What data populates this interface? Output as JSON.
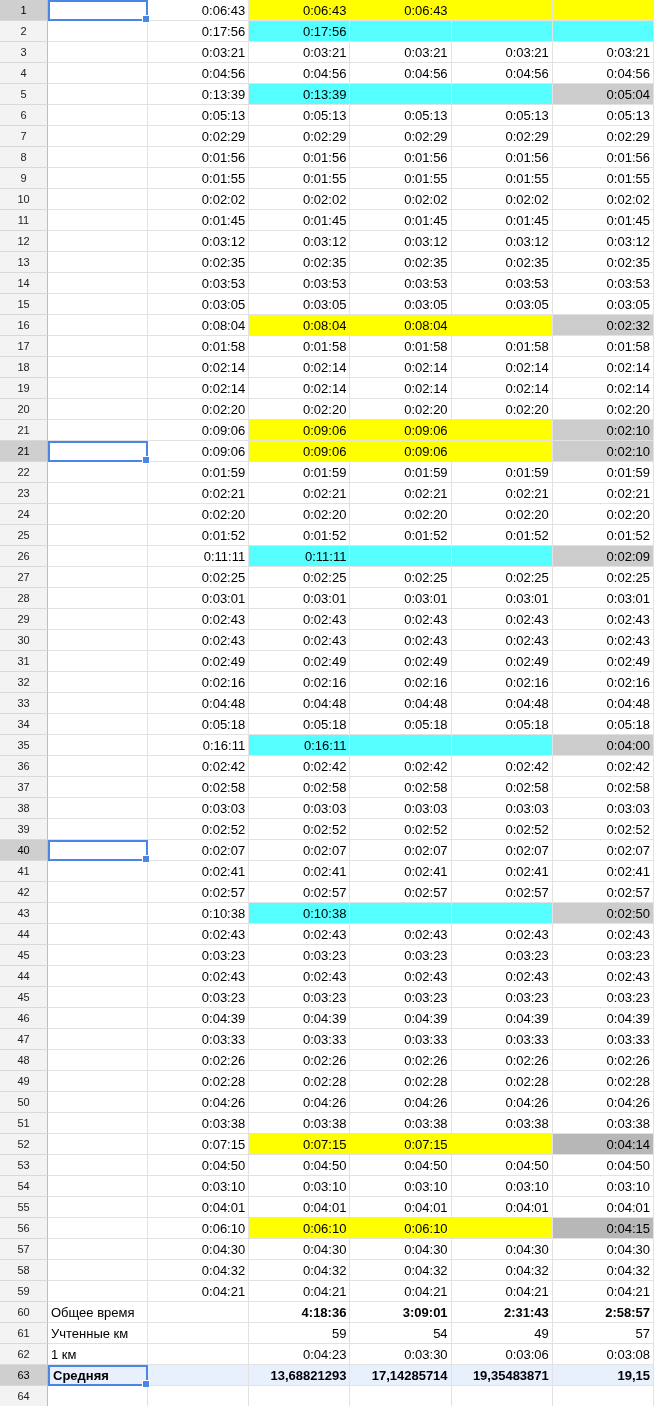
{
  "rows": [
    {
      "number": "1",
      "kind": "plain",
      "selected": true,
      "cells": [
        {},
        {
          "text": "0:06:43"
        },
        {
          "text": "0:06:43",
          "color": "#ffff00"
        },
        {
          "text": "0:06:43",
          "color": "#ffff00"
        },
        {
          "color": "#ffff00"
        },
        {
          "color": "#ffff00"
        }
      ]
    },
    {
      "number": "2",
      "kind": "plain",
      "selected": false,
      "cells": [
        {},
        {
          "text": "0:17:56"
        },
        {
          "text": "0:17:56",
          "color": "#55ffff"
        },
        {
          "color": "#55ffff"
        },
        {
          "color": "#55ffff"
        },
        {
          "color": "#55ffff"
        }
      ]
    },
    {
      "number": "3",
      "kind": "plain",
      "selected": false,
      "cells": [
        {},
        {
          "text": "0:03:21"
        },
        {
          "text": "0:03:21"
        },
        {
          "text": "0:03:21"
        },
        {
          "text": "0:03:21"
        },
        {
          "text": "0:03:21"
        }
      ]
    },
    {
      "number": "4",
      "kind": "plain",
      "selected": false,
      "cells": [
        {},
        {
          "text": "0:04:56"
        },
        {
          "text": "0:04:56"
        },
        {
          "text": "0:04:56"
        },
        {
          "text": "0:04:56"
        },
        {
          "text": "0:04:56"
        }
      ]
    },
    {
      "number": "5",
      "kind": "plain",
      "selected": false,
      "cells": [
        {},
        {
          "text": "0:13:39"
        },
        {
          "text": "0:13:39",
          "color": "#55ffff"
        },
        {
          "color": "#55ffff"
        },
        {
          "color": "#55ffff"
        },
        {
          "text": "0:05:04",
          "color": "#cccccc"
        }
      ]
    },
    {
      "number": "6",
      "kind": "plain",
      "selected": false,
      "cells": [
        {},
        {
          "text": "0:05:13"
        },
        {
          "text": "0:05:13"
        },
        {
          "text": "0:05:13"
        },
        {
          "text": "0:05:13"
        },
        {
          "text": "0:05:13"
        }
      ]
    },
    {
      "number": "7",
      "kind": "plain",
      "selected": false,
      "cells": [
        {},
        {
          "text": "0:02:29"
        },
        {
          "text": "0:02:29"
        },
        {
          "text": "0:02:29"
        },
        {
          "text": "0:02:29"
        },
        {
          "text": "0:02:29"
        }
      ]
    },
    {
      "number": "8",
      "kind": "plain",
      "selected": false,
      "cells": [
        {},
        {
          "text": "0:01:56"
        },
        {
          "text": "0:01:56"
        },
        {
          "text": "0:01:56"
        },
        {
          "text": "0:01:56"
        },
        {
          "text": "0:01:56"
        }
      ]
    },
    {
      "number": "9",
      "kind": "plain",
      "selected": false,
      "cells": [
        {},
        {
          "text": "0:01:55"
        },
        {
          "text": "0:01:55"
        },
        {
          "text": "0:01:55"
        },
        {
          "text": "0:01:55"
        },
        {
          "text": "0:01:55"
        }
      ]
    },
    {
      "number": "10",
      "kind": "plain",
      "selected": false,
      "cells": [
        {},
        {
          "text": "0:02:02"
        },
        {
          "text": "0:02:02"
        },
        {
          "text": "0:02:02"
        },
        {
          "text": "0:02:02"
        },
        {
          "text": "0:02:02"
        }
      ]
    },
    {
      "number": "11",
      "kind": "plain",
      "selected": false,
      "cells": [
        {},
        {
          "text": "0:01:45"
        },
        {
          "text": "0:01:45"
        },
        {
          "text": "0:01:45"
        },
        {
          "text": "0:01:45"
        },
        {
          "text": "0:01:45"
        }
      ]
    },
    {
      "number": "12",
      "kind": "plain",
      "selected": false,
      "cells": [
        {},
        {
          "text": "0:03:12"
        },
        {
          "text": "0:03:12"
        },
        {
          "text": "0:03:12"
        },
        {
          "text": "0:03:12"
        },
        {
          "text": "0:03:12"
        }
      ]
    },
    {
      "number": "13",
      "kind": "plain",
      "selected": false,
      "cells": [
        {},
        {
          "text": "0:02:35"
        },
        {
          "text": "0:02:35"
        },
        {
          "text": "0:02:35"
        },
        {
          "text": "0:02:35"
        },
        {
          "text": "0:02:35"
        }
      ]
    },
    {
      "number": "14",
      "kind": "plain",
      "selected": false,
      "cells": [
        {},
        {
          "text": "0:03:53"
        },
        {
          "text": "0:03:53"
        },
        {
          "text": "0:03:53"
        },
        {
          "text": "0:03:53"
        },
        {
          "text": "0:03:53"
        }
      ]
    },
    {
      "number": "15",
      "kind": "plain",
      "selected": false,
      "cells": [
        {},
        {
          "text": "0:03:05"
        },
        {
          "text": "0:03:05"
        },
        {
          "text": "0:03:05"
        },
        {
          "text": "0:03:05"
        },
        {
          "text": "0:03:05"
        }
      ]
    },
    {
      "number": "16",
      "kind": "plain",
      "selected": false,
      "cells": [
        {},
        {
          "text": "0:08:04"
        },
        {
          "text": "0:08:04",
          "color": "#ffff00"
        },
        {
          "text": "0:08:04",
          "color": "#ffff00"
        },
        {
          "color": "#ffff00"
        },
        {
          "text": "0:02:32",
          "color": "#cccccc"
        }
      ]
    },
    {
      "number": "17",
      "kind": "plain",
      "selected": false,
      "cells": [
        {},
        {
          "text": "0:01:58"
        },
        {
          "text": "0:01:58"
        },
        {
          "text": "0:01:58"
        },
        {
          "text": "0:01:58"
        },
        {
          "text": "0:01:58"
        }
      ]
    },
    {
      "number": "18",
      "kind": "plain",
      "selected": false,
      "cells": [
        {},
        {
          "text": "0:02:14"
        },
        {
          "text": "0:02:14"
        },
        {
          "text": "0:02:14"
        },
        {
          "text": "0:02:14"
        },
        {
          "text": "0:02:14"
        }
      ]
    },
    {
      "number": "19",
      "kind": "plain",
      "selected": false,
      "cells": [
        {},
        {
          "text": "0:02:14"
        },
        {
          "text": "0:02:14"
        },
        {
          "text": "0:02:14"
        },
        {
          "text": "0:02:14"
        },
        {
          "text": "0:02:14"
        }
      ]
    },
    {
      "number": "20",
      "kind": "plain",
      "selected": false,
      "cells": [
        {},
        {
          "text": "0:02:20"
        },
        {
          "text": "0:02:20"
        },
        {
          "text": "0:02:20"
        },
        {
          "text": "0:02:20"
        },
        {
          "text": "0:02:20"
        }
      ]
    },
    {
      "number": "21",
      "kind": "plain",
      "selected": false,
      "cells": [
        {},
        {
          "text": "0:09:06"
        },
        {
          "text": "0:09:06",
          "color": "#ffff00"
        },
        {
          "text": "0:09:06",
          "color": "#ffff00"
        },
        {
          "color": "#ffff00"
        },
        {
          "text": "0:02:10",
          "color": "#cccccc"
        }
      ]
    },
    {
      "number": "21",
      "kind": "plain",
      "selected": true,
      "cells": [
        {},
        {
          "text": "0:09:06"
        },
        {
          "text": "0:09:06",
          "color": "#ffff00"
        },
        {
          "text": "0:09:06",
          "color": "#ffff00"
        },
        {
          "color": "#ffff00"
        },
        {
          "text": "0:02:10",
          "color": "#cccccc"
        }
      ]
    },
    {
      "number": "22",
      "kind": "plain",
      "selected": false,
      "cells": [
        {},
        {
          "text": "0:01:59"
        },
        {
          "text": "0:01:59"
        },
        {
          "text": "0:01:59"
        },
        {
          "text": "0:01:59"
        },
        {
          "text": "0:01:59"
        }
      ]
    },
    {
      "number": "23",
      "kind": "plain",
      "selected": false,
      "cells": [
        {},
        {
          "text": "0:02:21"
        },
        {
          "text": "0:02:21"
        },
        {
          "text": "0:02:21"
        },
        {
          "text": "0:02:21"
        },
        {
          "text": "0:02:21"
        }
      ]
    },
    {
      "number": "24",
      "kind": "plain",
      "selected": false,
      "cells": [
        {},
        {
          "text": "0:02:20"
        },
        {
          "text": "0:02:20"
        },
        {
          "text": "0:02:20"
        },
        {
          "text": "0:02:20"
        },
        {
          "text": "0:02:20"
        }
      ]
    },
    {
      "number": "25",
      "kind": "plain",
      "selected": false,
      "cells": [
        {},
        {
          "text": "0:01:52"
        },
        {
          "text": "0:01:52"
        },
        {
          "text": "0:01:52"
        },
        {
          "text": "0:01:52"
        },
        {
          "text": "0:01:52"
        }
      ]
    },
    {
      "number": "26",
      "kind": "plain",
      "selected": false,
      "cells": [
        {},
        {
          "text": "0:11:11"
        },
        {
          "text": "0:11:11",
          "color": "#55ffff"
        },
        {
          "color": "#55ffff"
        },
        {
          "color": "#55ffff"
        },
        {
          "text": "0:02:09",
          "color": "#cccccc"
        }
      ]
    },
    {
      "number": "27",
      "kind": "plain",
      "selected": false,
      "cells": [
        {},
        {
          "text": "0:02:25"
        },
        {
          "text": "0:02:25"
        },
        {
          "text": "0:02:25"
        },
        {
          "text": "0:02:25"
        },
        {
          "text": "0:02:25"
        }
      ]
    },
    {
      "number": "28",
      "kind": "plain",
      "selected": false,
      "cells": [
        {},
        {
          "text": "0:03:01"
        },
        {
          "text": "0:03:01"
        },
        {
          "text": "0:03:01"
        },
        {
          "text": "0:03:01"
        },
        {
          "text": "0:03:01"
        }
      ]
    },
    {
      "number": "29",
      "kind": "plain",
      "selected": false,
      "cells": [
        {},
        {
          "text": "0:02:43"
        },
        {
          "text": "0:02:43"
        },
        {
          "text": "0:02:43"
        },
        {
          "text": "0:02:43"
        },
        {
          "text": "0:02:43"
        }
      ]
    },
    {
      "number": "30",
      "kind": "plain",
      "selected": false,
      "cells": [
        {},
        {
          "text": "0:02:43"
        },
        {
          "text": "0:02:43"
        },
        {
          "text": "0:02:43"
        },
        {
          "text": "0:02:43"
        },
        {
          "text": "0:02:43"
        }
      ]
    },
    {
      "number": "31",
      "kind": "plain",
      "selected": false,
      "cells": [
        {},
        {
          "text": "0:02:49"
        },
        {
          "text": "0:02:49"
        },
        {
          "text": "0:02:49"
        },
        {
          "text": "0:02:49"
        },
        {
          "text": "0:02:49"
        }
      ]
    },
    {
      "number": "32",
      "kind": "plain",
      "selected": false,
      "cells": [
        {},
        {
          "text": "0:02:16"
        },
        {
          "text": "0:02:16"
        },
        {
          "text": "0:02:16"
        },
        {
          "text": "0:02:16"
        },
        {
          "text": "0:02:16"
        }
      ]
    },
    {
      "number": "33",
      "kind": "plain",
      "selected": false,
      "cells": [
        {},
        {
          "text": "0:04:48"
        },
        {
          "text": "0:04:48"
        },
        {
          "text": "0:04:48"
        },
        {
          "text": "0:04:48"
        },
        {
          "text": "0:04:48"
        }
      ]
    },
    {
      "number": "34",
      "kind": "plain",
      "selected": false,
      "cells": [
        {},
        {
          "text": "0:05:18"
        },
        {
          "text": "0:05:18"
        },
        {
          "text": "0:05:18"
        },
        {
          "text": "0:05:18"
        },
        {
          "text": "0:05:18"
        }
      ]
    },
    {
      "number": "35",
      "kind": "plain",
      "selected": false,
      "cells": [
        {},
        {
          "text": "0:16:11"
        },
        {
          "text": "0:16:11",
          "color": "#55ffff"
        },
        {
          "color": "#55ffff"
        },
        {
          "color": "#55ffff"
        },
        {
          "text": "0:04:00",
          "color": "#cccccc"
        }
      ]
    },
    {
      "number": "36",
      "kind": "plain",
      "selected": false,
      "cells": [
        {},
        {
          "text": "0:02:42"
        },
        {
          "text": "0:02:42"
        },
        {
          "text": "0:02:42"
        },
        {
          "text": "0:02:42"
        },
        {
          "text": "0:02:42"
        }
      ]
    },
    {
      "number": "37",
      "kind": "plain",
      "selected": false,
      "cells": [
        {},
        {
          "text": "0:02:58"
        },
        {
          "text": "0:02:58"
        },
        {
          "text": "0:02:58"
        },
        {
          "text": "0:02:58"
        },
        {
          "text": "0:02:58"
        }
      ]
    },
    {
      "number": "38",
      "kind": "plain",
      "selected": false,
      "cells": [
        {},
        {
          "text": "0:03:03"
        },
        {
          "text": "0:03:03"
        },
        {
          "text": "0:03:03"
        },
        {
          "text": "0:03:03"
        },
        {
          "text": "0:03:03"
        }
      ]
    },
    {
      "number": "39",
      "kind": "plain",
      "selected": false,
      "cells": [
        {},
        {
          "text": "0:02:52"
        },
        {
          "text": "0:02:52"
        },
        {
          "text": "0:02:52"
        },
        {
          "text": "0:02:52"
        },
        {
          "text": "0:02:52"
        }
      ]
    },
    {
      "number": "40",
      "kind": "plain",
      "selected": true,
      "cells": [
        {},
        {
          "text": "0:02:07"
        },
        {
          "text": "0:02:07"
        },
        {
          "text": "0:02:07"
        },
        {
          "text": "0:02:07"
        },
        {
          "text": "0:02:07"
        }
      ]
    },
    {
      "number": "41",
      "kind": "plain",
      "selected": false,
      "cells": [
        {},
        {
          "text": "0:02:41"
        },
        {
          "text": "0:02:41"
        },
        {
          "text": "0:02:41"
        },
        {
          "text": "0:02:41"
        },
        {
          "text": "0:02:41"
        }
      ]
    },
    {
      "number": "42",
      "kind": "plain",
      "selected": false,
      "cells": [
        {},
        {
          "text": "0:02:57"
        },
        {
          "text": "0:02:57"
        },
        {
          "text": "0:02:57"
        },
        {
          "text": "0:02:57"
        },
        {
          "text": "0:02:57"
        }
      ]
    },
    {
      "number": "43",
      "kind": "plain",
      "selected": false,
      "cells": [
        {},
        {
          "text": "0:10:38"
        },
        {
          "text": "0:10:38",
          "color": "#55ffff"
        },
        {
          "color": "#55ffff"
        },
        {
          "color": "#55ffff"
        },
        {
          "text": "0:02:50",
          "color": "#cccccc"
        }
      ]
    },
    {
      "number": "44",
      "kind": "plain",
      "selected": false,
      "cells": [
        {},
        {
          "text": "0:02:43"
        },
        {
          "text": "0:02:43"
        },
        {
          "text": "0:02:43"
        },
        {
          "text": "0:02:43"
        },
        {
          "text": "0:02:43"
        }
      ]
    },
    {
      "number": "45",
      "kind": "plain",
      "selected": false,
      "cells": [
        {},
        {
          "text": "0:03:23"
        },
        {
          "text": "0:03:23"
        },
        {
          "text": "0:03:23"
        },
        {
          "text": "0:03:23"
        },
        {
          "text": "0:03:23"
        }
      ]
    },
    {
      "number": "44",
      "kind": "plain",
      "selected": false,
      "cells": [
        {},
        {
          "text": "0:02:43"
        },
        {
          "text": "0:02:43"
        },
        {
          "text": "0:02:43"
        },
        {
          "text": "0:02:43"
        },
        {
          "text": "0:02:43"
        }
      ]
    },
    {
      "number": "45",
      "kind": "plain",
      "selected": false,
      "cells": [
        {},
        {
          "text": "0:03:23"
        },
        {
          "text": "0:03:23"
        },
        {
          "text": "0:03:23"
        },
        {
          "text": "0:03:23"
        },
        {
          "text": "0:03:23"
        }
      ]
    },
    {
      "number": "46",
      "kind": "plain",
      "selected": false,
      "cells": [
        {},
        {
          "text": "0:04:39"
        },
        {
          "text": "0:04:39"
        },
        {
          "text": "0:04:39"
        },
        {
          "text": "0:04:39"
        },
        {
          "text": "0:04:39"
        }
      ]
    },
    {
      "number": "47",
      "kind": "plain",
      "selected": false,
      "cells": [
        {},
        {
          "text": "0:03:33"
        },
        {
          "text": "0:03:33"
        },
        {
          "text": "0:03:33"
        },
        {
          "text": "0:03:33"
        },
        {
          "text": "0:03:33"
        }
      ]
    },
    {
      "number": "48",
      "kind": "plain",
      "selected": false,
      "cells": [
        {},
        {
          "text": "0:02:26"
        },
        {
          "text": "0:02:26"
        },
        {
          "text": "0:02:26"
        },
        {
          "text": "0:02:26"
        },
        {
          "text": "0:02:26"
        }
      ]
    },
    {
      "number": "49",
      "kind": "plain",
      "selected": false,
      "cells": [
        {},
        {
          "text": "0:02:28"
        },
        {
          "text": "0:02:28"
        },
        {
          "text": "0:02:28"
        },
        {
          "text": "0:02:28"
        },
        {
          "text": "0:02:28"
        }
      ]
    },
    {
      "number": "50",
      "kind": "plain",
      "selected": false,
      "cells": [
        {},
        {
          "text": "0:04:26"
        },
        {
          "text": "0:04:26"
        },
        {
          "text": "0:04:26"
        },
        {
          "text": "0:04:26"
        },
        {
          "text": "0:04:26"
        }
      ]
    },
    {
      "number": "51",
      "kind": "plain",
      "selected": false,
      "cells": [
        {},
        {
          "text": "0:03:38"
        },
        {
          "text": "0:03:38"
        },
        {
          "text": "0:03:38"
        },
        {
          "text": "0:03:38"
        },
        {
          "text": "0:03:38"
        }
      ]
    },
    {
      "number": "52",
      "kind": "plain",
      "selected": false,
      "cells": [
        {},
        {
          "text": "0:07:15"
        },
        {
          "text": "0:07:15",
          "color": "#ffff00"
        },
        {
          "text": "0:07:15",
          "color": "#ffff00"
        },
        {
          "color": "#ffff00"
        },
        {
          "text": "0:04:14",
          "color": "#b7b7b7"
        }
      ]
    },
    {
      "number": "53",
      "kind": "plain",
      "selected": false,
      "cells": [
        {},
        {
          "text": "0:04:50"
        },
        {
          "text": "0:04:50"
        },
        {
          "text": "0:04:50"
        },
        {
          "text": "0:04:50"
        },
        {
          "text": "0:04:50"
        }
      ]
    },
    {
      "number": "54",
      "kind": "plain",
      "selected": false,
      "cells": [
        {},
        {
          "text": "0:03:10"
        },
        {
          "text": "0:03:10"
        },
        {
          "text": "0:03:10"
        },
        {
          "text": "0:03:10"
        },
        {
          "text": "0:03:10"
        }
      ]
    },
    {
      "number": "55",
      "kind": "plain",
      "selected": false,
      "cells": [
        {},
        {
          "text": "0:04:01"
        },
        {
          "text": "0:04:01"
        },
        {
          "text": "0:04:01"
        },
        {
          "text": "0:04:01"
        },
        {
          "text": "0:04:01"
        }
      ]
    },
    {
      "number": "56",
      "kind": "plain",
      "selected": false,
      "cells": [
        {},
        {
          "text": "0:06:10"
        },
        {
          "text": "0:06:10",
          "color": "#ffff00"
        },
        {
          "text": "0:06:10",
          "color": "#ffff00"
        },
        {
          "color": "#ffff00"
        },
        {
          "text": "0:04:15",
          "color": "#b7b7b7"
        }
      ]
    },
    {
      "number": "57",
      "kind": "plain",
      "selected": false,
      "cells": [
        {},
        {
          "text": "0:04:30"
        },
        {
          "text": "0:04:30"
        },
        {
          "text": "0:04:30"
        },
        {
          "text": "0:04:30"
        },
        {
          "text": "0:04:30"
        }
      ]
    },
    {
      "number": "58",
      "kind": "plain",
      "selected": false,
      "cells": [
        {},
        {
          "text": "0:04:32"
        },
        {
          "text": "0:04:32"
        },
        {
          "text": "0:04:32"
        },
        {
          "text": "0:04:32"
        },
        {
          "text": "0:04:32"
        }
      ]
    },
    {
      "number": "59",
      "kind": "plain",
      "selected": false,
      "cells": [
        {},
        {
          "text": "0:04:21"
        },
        {
          "text": "0:04:21"
        },
        {
          "text": "0:04:21"
        },
        {
          "text": "0:04:21"
        },
        {
          "text": "0:04:21"
        }
      ]
    },
    {
      "number": "60",
      "kind": "total",
      "selected": false,
      "cells": [
        {
          "text": "Общее время"
        },
        {},
        {
          "text": "4:18:36"
        },
        {
          "text": "3:09:01"
        },
        {
          "text": "2:31:43"
        },
        {
          "text": "2:58:57"
        }
      ]
    },
    {
      "number": "61",
      "kind": "plain",
      "selected": false,
      "cells": [
        {
          "text": "Учтенные км"
        },
        {},
        {
          "text": "59"
        },
        {
          "text": "54"
        },
        {
          "text": "49"
        },
        {
          "text": "57"
        }
      ]
    },
    {
      "number": "62",
      "kind": "plain",
      "selected": false,
      "cells": [
        {
          "text": "1 км"
        },
        {},
        {
          "text": "0:04:23"
        },
        {
          "text": "0:03:30"
        },
        {
          "text": "0:03:06"
        },
        {
          "text": "0:03:08"
        }
      ]
    },
    {
      "number": "63",
      "kind": "average",
      "selected": true,
      "cells": [
        {
          "text": "Средняя"
        },
        {},
        {
          "text": "13,68821293"
        },
        {
          "text": "17,14285714"
        },
        {
          "text": "19,35483871"
        },
        {
          "text": "19,15"
        }
      ]
    },
    {
      "number": "64",
      "kind": "plain",
      "selected": false,
      "cells": [
        {},
        {},
        {},
        {},
        {},
        {}
      ]
    }
  ]
}
